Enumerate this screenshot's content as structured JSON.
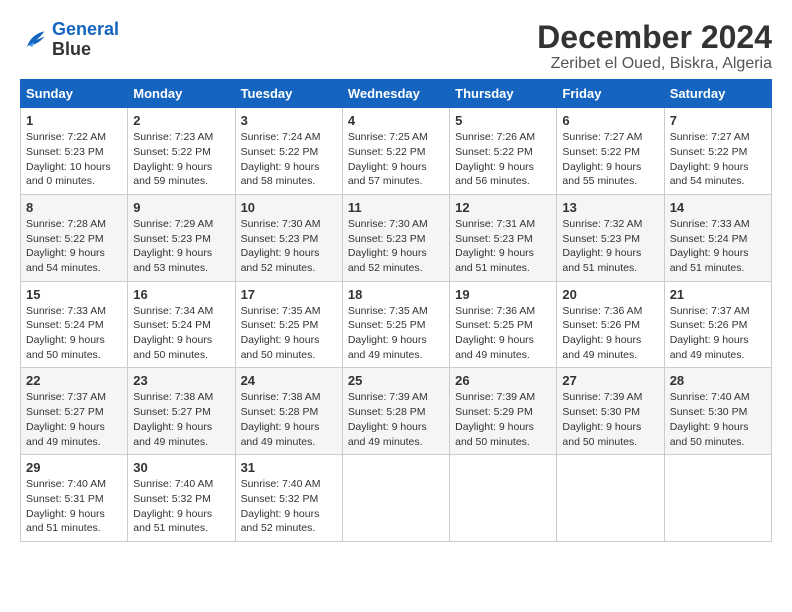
{
  "header": {
    "logo_line1": "General",
    "logo_line2": "Blue",
    "title": "December 2024",
    "subtitle": "Zeribet el Oued, Biskra, Algeria"
  },
  "days_of_week": [
    "Sunday",
    "Monday",
    "Tuesday",
    "Wednesday",
    "Thursday",
    "Friday",
    "Saturday"
  ],
  "weeks": [
    [
      {
        "day": 1,
        "sunrise": "Sunrise: 7:22 AM",
        "sunset": "Sunset: 5:23 PM",
        "daylight": "Daylight: 10 hours and 0 minutes."
      },
      {
        "day": 2,
        "sunrise": "Sunrise: 7:23 AM",
        "sunset": "Sunset: 5:22 PM",
        "daylight": "Daylight: 9 hours and 59 minutes."
      },
      {
        "day": 3,
        "sunrise": "Sunrise: 7:24 AM",
        "sunset": "Sunset: 5:22 PM",
        "daylight": "Daylight: 9 hours and 58 minutes."
      },
      {
        "day": 4,
        "sunrise": "Sunrise: 7:25 AM",
        "sunset": "Sunset: 5:22 PM",
        "daylight": "Daylight: 9 hours and 57 minutes."
      },
      {
        "day": 5,
        "sunrise": "Sunrise: 7:26 AM",
        "sunset": "Sunset: 5:22 PM",
        "daylight": "Daylight: 9 hours and 56 minutes."
      },
      {
        "day": 6,
        "sunrise": "Sunrise: 7:27 AM",
        "sunset": "Sunset: 5:22 PM",
        "daylight": "Daylight: 9 hours and 55 minutes."
      },
      {
        "day": 7,
        "sunrise": "Sunrise: 7:27 AM",
        "sunset": "Sunset: 5:22 PM",
        "daylight": "Daylight: 9 hours and 54 minutes."
      }
    ],
    [
      {
        "day": 8,
        "sunrise": "Sunrise: 7:28 AM",
        "sunset": "Sunset: 5:22 PM",
        "daylight": "Daylight: 9 hours and 54 minutes."
      },
      {
        "day": 9,
        "sunrise": "Sunrise: 7:29 AM",
        "sunset": "Sunset: 5:23 PM",
        "daylight": "Daylight: 9 hours and 53 minutes."
      },
      {
        "day": 10,
        "sunrise": "Sunrise: 7:30 AM",
        "sunset": "Sunset: 5:23 PM",
        "daylight": "Daylight: 9 hours and 52 minutes."
      },
      {
        "day": 11,
        "sunrise": "Sunrise: 7:30 AM",
        "sunset": "Sunset: 5:23 PM",
        "daylight": "Daylight: 9 hours and 52 minutes."
      },
      {
        "day": 12,
        "sunrise": "Sunrise: 7:31 AM",
        "sunset": "Sunset: 5:23 PM",
        "daylight": "Daylight: 9 hours and 51 minutes."
      },
      {
        "day": 13,
        "sunrise": "Sunrise: 7:32 AM",
        "sunset": "Sunset: 5:23 PM",
        "daylight": "Daylight: 9 hours and 51 minutes."
      },
      {
        "day": 14,
        "sunrise": "Sunrise: 7:33 AM",
        "sunset": "Sunset: 5:24 PM",
        "daylight": "Daylight: 9 hours and 51 minutes."
      }
    ],
    [
      {
        "day": 15,
        "sunrise": "Sunrise: 7:33 AM",
        "sunset": "Sunset: 5:24 PM",
        "daylight": "Daylight: 9 hours and 50 minutes."
      },
      {
        "day": 16,
        "sunrise": "Sunrise: 7:34 AM",
        "sunset": "Sunset: 5:24 PM",
        "daylight": "Daylight: 9 hours and 50 minutes."
      },
      {
        "day": 17,
        "sunrise": "Sunrise: 7:35 AM",
        "sunset": "Sunset: 5:25 PM",
        "daylight": "Daylight: 9 hours and 50 minutes."
      },
      {
        "day": 18,
        "sunrise": "Sunrise: 7:35 AM",
        "sunset": "Sunset: 5:25 PM",
        "daylight": "Daylight: 9 hours and 49 minutes."
      },
      {
        "day": 19,
        "sunrise": "Sunrise: 7:36 AM",
        "sunset": "Sunset: 5:25 PM",
        "daylight": "Daylight: 9 hours and 49 minutes."
      },
      {
        "day": 20,
        "sunrise": "Sunrise: 7:36 AM",
        "sunset": "Sunset: 5:26 PM",
        "daylight": "Daylight: 9 hours and 49 minutes."
      },
      {
        "day": 21,
        "sunrise": "Sunrise: 7:37 AM",
        "sunset": "Sunset: 5:26 PM",
        "daylight": "Daylight: 9 hours and 49 minutes."
      }
    ],
    [
      {
        "day": 22,
        "sunrise": "Sunrise: 7:37 AM",
        "sunset": "Sunset: 5:27 PM",
        "daylight": "Daylight: 9 hours and 49 minutes."
      },
      {
        "day": 23,
        "sunrise": "Sunrise: 7:38 AM",
        "sunset": "Sunset: 5:27 PM",
        "daylight": "Daylight: 9 hours and 49 minutes."
      },
      {
        "day": 24,
        "sunrise": "Sunrise: 7:38 AM",
        "sunset": "Sunset: 5:28 PM",
        "daylight": "Daylight: 9 hours and 49 minutes."
      },
      {
        "day": 25,
        "sunrise": "Sunrise: 7:39 AM",
        "sunset": "Sunset: 5:28 PM",
        "daylight": "Daylight: 9 hours and 49 minutes."
      },
      {
        "day": 26,
        "sunrise": "Sunrise: 7:39 AM",
        "sunset": "Sunset: 5:29 PM",
        "daylight": "Daylight: 9 hours and 50 minutes."
      },
      {
        "day": 27,
        "sunrise": "Sunrise: 7:39 AM",
        "sunset": "Sunset: 5:30 PM",
        "daylight": "Daylight: 9 hours and 50 minutes."
      },
      {
        "day": 28,
        "sunrise": "Sunrise: 7:40 AM",
        "sunset": "Sunset: 5:30 PM",
        "daylight": "Daylight: 9 hours and 50 minutes."
      }
    ],
    [
      {
        "day": 29,
        "sunrise": "Sunrise: 7:40 AM",
        "sunset": "Sunset: 5:31 PM",
        "daylight": "Daylight: 9 hours and 51 minutes."
      },
      {
        "day": 30,
        "sunrise": "Sunrise: 7:40 AM",
        "sunset": "Sunset: 5:32 PM",
        "daylight": "Daylight: 9 hours and 51 minutes."
      },
      {
        "day": 31,
        "sunrise": "Sunrise: 7:40 AM",
        "sunset": "Sunset: 5:32 PM",
        "daylight": "Daylight: 9 hours and 52 minutes."
      },
      null,
      null,
      null,
      null
    ]
  ]
}
